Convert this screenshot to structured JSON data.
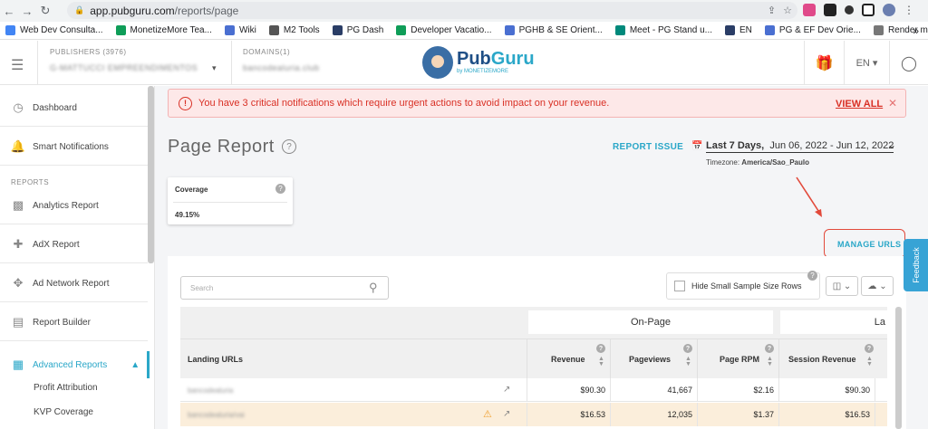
{
  "browser": {
    "url_host": "app.pubguru.com",
    "url_path": "/reports/page",
    "bookmarks": [
      {
        "label": "Web Dev Consulta...",
        "color": "#4285f4"
      },
      {
        "label": "MonetizeMore Tea...",
        "color": "#0f9d58"
      },
      {
        "label": "Wiki",
        "color": "#4a6fd1"
      },
      {
        "label": "M2 Tools",
        "color": "#555555"
      },
      {
        "label": "PG Dash",
        "color": "#2a3d66"
      },
      {
        "label": "Developer Vacatio...",
        "color": "#0f9d58"
      },
      {
        "label": "PGHB & SE Orient...",
        "color": "#4a6fd1"
      },
      {
        "label": "Meet - PG Stand u...",
        "color": "#00897b"
      },
      {
        "label": "EN",
        "color": "#2a3d66"
      },
      {
        "label": "PG & EF Dev Orie...",
        "color": "#4a6fd1"
      },
      {
        "label": "Render more than...",
        "color": "#777777"
      }
    ]
  },
  "header": {
    "publishers_label": "PUBLISHERS (3976)",
    "publishers_value": "G-MATTUCCI EMPREENDIMENTOS",
    "domains_label": "DOMAINS(1)",
    "domains_value": "bancodealuria.club",
    "logo_pub": "Pub",
    "logo_guru": "Guru",
    "logo_sub": "by MONETIZEMORE",
    "language": "EN"
  },
  "sidebar": {
    "items": [
      {
        "label": "Dashboard",
        "icon": "dashboard-icon"
      },
      {
        "label": "Smart Notifications",
        "icon": "bell-icon"
      },
      {
        "label": "Analytics Report",
        "icon": "bar-chart-icon"
      },
      {
        "label": "AdX Report",
        "icon": "adx-icon"
      },
      {
        "label": "Ad Network Report",
        "icon": "network-icon"
      },
      {
        "label": "Report Builder",
        "icon": "report-builder-icon"
      },
      {
        "label": "Advanced Reports",
        "icon": "advanced-reports-icon"
      }
    ],
    "section_reports": "REPORTS",
    "sub_items": [
      "Profit Attribution",
      "KVP Coverage"
    ],
    "accent": "#2aa7c8"
  },
  "alert": {
    "message": "You have 3 critical notifications which require urgent actions to avoid impact on your revenue.",
    "view_all": "VIEW ALL"
  },
  "page": {
    "title": "Page Report",
    "report_issue": "REPORT ISSUE",
    "date_label": "Last 7 Days,",
    "date_range": "Jun 06, 2022 - Jun 12, 2022",
    "timezone_label": "Timezone:",
    "timezone_value": "America/Sao_Paulo",
    "coverage_title": "Coverage",
    "coverage_value": "49.15%",
    "manage_urls": "MANAGE URLS",
    "feedback": "Feedback"
  },
  "table": {
    "search_placeholder": "Search",
    "hide_small_label": "Hide Small Sample Size Rows",
    "group_on_page": "On-Page",
    "group_next": "La",
    "col_landing": "Landing URLs",
    "columns": [
      "Revenue",
      "Pageviews",
      "Page RPM",
      "Session Revenue"
    ],
    "rows": [
      {
        "url": "bancodealuria",
        "revenue": "$90.30",
        "pageviews": "41,667",
        "rpm": "$2.16",
        "session_revenue": "$90.30",
        "warn": false
      },
      {
        "url": "bancodealuria/vai",
        "revenue": "$16.53",
        "pageviews": "12,035",
        "rpm": "$1.37",
        "session_revenue": "$16.53",
        "warn": true
      }
    ]
  }
}
